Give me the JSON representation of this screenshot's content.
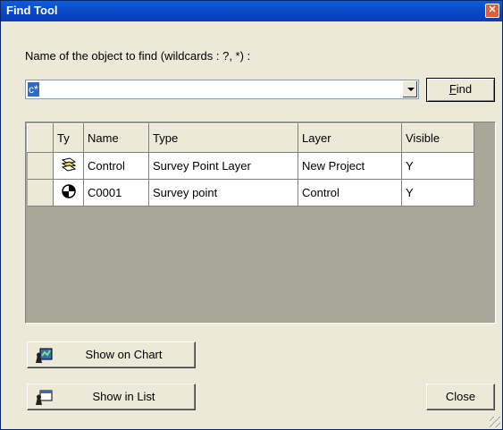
{
  "window": {
    "title": "Find Tool"
  },
  "search": {
    "prompt": "Name of the object to find (wildcards : ?, *) :",
    "value": "c*",
    "find_label": "Find"
  },
  "grid": {
    "columns": [
      "Ty",
      "Name",
      "Type",
      "Layer",
      "Visible"
    ],
    "rows": [
      {
        "icon": "survey-layer-icon",
        "name": "Control",
        "type": "Survey Point Layer",
        "layer": "New Project",
        "visible": "Y"
      },
      {
        "icon": "survey-point-icon",
        "name": "C0001",
        "type": "Survey point",
        "layer": "Control",
        "visible": "Y"
      }
    ]
  },
  "buttons": {
    "show_on_chart": "Show on Chart",
    "show_in_list": "Show in List",
    "close": "Close"
  }
}
